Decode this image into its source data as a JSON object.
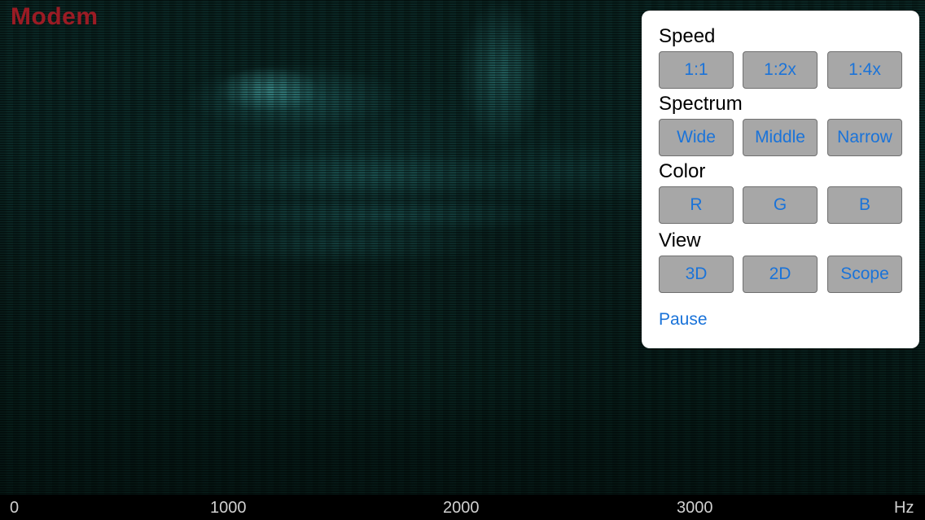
{
  "app": {
    "title": "Modem",
    "title_color": "#9b1b24"
  },
  "frequency_axis": {
    "labels": [
      "0",
      "1000",
      "2000",
      "3000",
      "Hz"
    ]
  },
  "panel": {
    "speed": {
      "title": "Speed",
      "buttons": [
        "1:1",
        "1:2x",
        "1:4x"
      ]
    },
    "spectrum": {
      "title": "Spectrum",
      "buttons": [
        "Wide",
        "Middle",
        "Narrow"
      ]
    },
    "color": {
      "title": "Color",
      "buttons": [
        "R",
        "G",
        "B"
      ]
    },
    "view": {
      "title": "View",
      "buttons": [
        "3D",
        "2D",
        "Scope"
      ]
    },
    "pause_label": "Pause"
  },
  "colors": {
    "accent_blue": "#1a73d9",
    "button_gray": "#a7a7a7",
    "spectrogram_teal": "#4fb3b0"
  }
}
